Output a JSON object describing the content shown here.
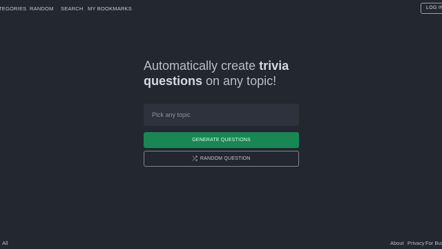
{
  "nav": {
    "categories": "TEGORIES",
    "random": "RANDOM",
    "search": "SEARCH",
    "bookmarks": "MY BOOKMARKS",
    "login": "LOG IN"
  },
  "hero": {
    "line1_prefix": "Automatically create ",
    "line1_bold": "trivia",
    "line2_bold": "questions",
    "line2_suffix": " on any topic!"
  },
  "form": {
    "topic_placeholder": "Pick any topic",
    "topic_value": "",
    "generate_label": "GENERATE QUESTIONS",
    "random_label": "RANDOM QUESTION",
    "random_icon": "shuffle-icon"
  },
  "footer": {
    "all": "All",
    "about": "About",
    "privacy": "Privacy",
    "for_business": "For Bus"
  },
  "colors": {
    "background": "#232730",
    "input_bg": "#2d323c",
    "accent_green": "#198754"
  }
}
